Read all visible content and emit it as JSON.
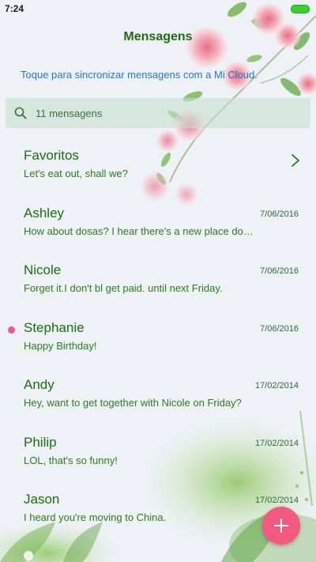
{
  "status_bar": {
    "time": "7:24"
  },
  "header": {
    "title": "Mensagens"
  },
  "sync": {
    "text": "Toque para sincronizar mensagens com a Mi Cloud."
  },
  "search": {
    "text": "11 mensagens"
  },
  "conversations": [
    {
      "name": "Favoritos",
      "preview": "Let's eat out, shall we?",
      "date": "",
      "unread": false
    },
    {
      "name": "Ashley",
      "preview": "How about dosas? I hear there's a new place do…",
      "date": "7/06/2016",
      "unread": false
    },
    {
      "name": "Nicole",
      "preview": "Forget it.I don't bl get paid. until next Friday.",
      "date": "7/06/2016",
      "unread": false
    },
    {
      "name": "Stephanie",
      "preview": "Happy Birthday!",
      "date": "7/06/2016",
      "unread": true
    },
    {
      "name": "Andy",
      "preview": "Hey, want to get together with Nicole on Friday?",
      "date": "17/02/2014",
      "unread": false
    },
    {
      "name": "Philip",
      "preview": "LOL, that's so funny!",
      "date": "17/02/2014",
      "unread": false
    },
    {
      "name": "Jason",
      "preview": "I heard you're moving to China.",
      "date": "17/02/2014",
      "unread": false
    }
  ],
  "icons": {
    "search": "search-icon",
    "chevron": "chevron-right-icon",
    "compose": "plus-icon",
    "battery": "battery-icon"
  },
  "colors": {
    "accent": "#f25a82",
    "text_green": "#1e6b12",
    "link_blue": "#1e78c8",
    "unread_dot": "#f05a86"
  }
}
